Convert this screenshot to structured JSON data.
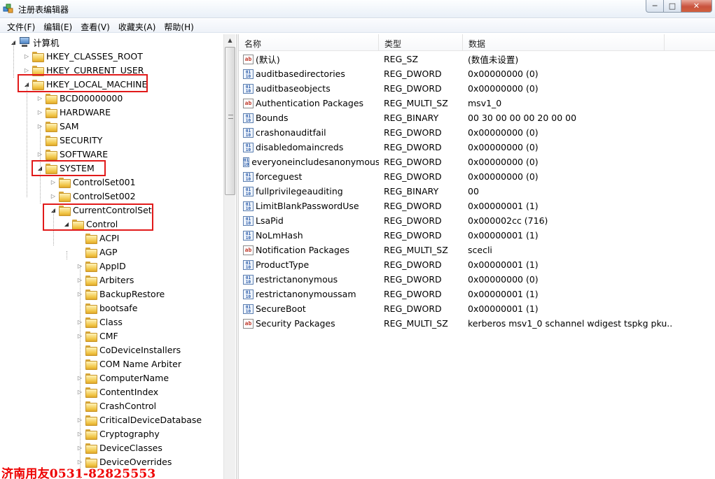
{
  "window": {
    "title": "注册表编辑器"
  },
  "menu": [
    "文件(F)",
    "编辑(E)",
    "查看(V)",
    "收藏夹(A)",
    "帮助(H)"
  ],
  "tree": [
    {
      "label": "计算机",
      "expander": "open",
      "icon": "computer-icon"
    },
    {
      "label": "HKEY_CLASSES_ROOT",
      "expander": "closed",
      "icon": "folder-icon"
    },
    {
      "label": "HKEY_CURRENT_USER",
      "expander": "closed",
      "icon": "folder-icon"
    },
    {
      "label": "HKEY_LOCAL_MACHINE",
      "expander": "open",
      "icon": "folder-icon"
    },
    {
      "label": "BCD00000000",
      "expander": "closed",
      "icon": "folder-icon"
    },
    {
      "label": "HARDWARE",
      "expander": "closed",
      "icon": "folder-icon"
    },
    {
      "label": "SAM",
      "expander": "closed",
      "icon": "folder-icon"
    },
    {
      "label": "SECURITY",
      "expander": "none",
      "icon": "folder-icon"
    },
    {
      "label": "SOFTWARE",
      "expander": "closed",
      "icon": "folder-icon"
    },
    {
      "label": "SYSTEM",
      "expander": "open",
      "icon": "folder-icon"
    },
    {
      "label": "ControlSet001",
      "expander": "closed",
      "icon": "folder-icon"
    },
    {
      "label": "ControlSet002",
      "expander": "closed",
      "icon": "folder-icon"
    },
    {
      "label": "CurrentControlSet",
      "expander": "open",
      "icon": "folder-icon"
    },
    {
      "label": "Control",
      "expander": "open",
      "icon": "folder-icon"
    },
    {
      "label": "ACPI",
      "expander": "none",
      "icon": "folder-icon"
    },
    {
      "label": "AGP",
      "expander": "none",
      "icon": "folder-icon"
    },
    {
      "label": "AppID",
      "expander": "closed",
      "icon": "folder-icon"
    },
    {
      "label": "Arbiters",
      "expander": "closed",
      "icon": "folder-icon"
    },
    {
      "label": "BackupRestore",
      "expander": "closed",
      "icon": "folder-icon"
    },
    {
      "label": "bootsafe",
      "expander": "none",
      "icon": "folder-icon"
    },
    {
      "label": "Class",
      "expander": "closed",
      "icon": "folder-icon"
    },
    {
      "label": "CMF",
      "expander": "closed",
      "icon": "folder-icon"
    },
    {
      "label": "CoDeviceInstallers",
      "expander": "none",
      "icon": "folder-icon"
    },
    {
      "label": "COM Name Arbiter",
      "expander": "none",
      "icon": "folder-icon"
    },
    {
      "label": "ComputerName",
      "expander": "closed",
      "icon": "folder-icon"
    },
    {
      "label": "ContentIndex",
      "expander": "closed",
      "icon": "folder-icon"
    },
    {
      "label": "CrashControl",
      "expander": "none",
      "icon": "folder-icon"
    },
    {
      "label": "CriticalDeviceDatabase",
      "expander": "closed",
      "icon": "folder-icon"
    },
    {
      "label": "Cryptography",
      "expander": "closed",
      "icon": "folder-icon"
    },
    {
      "label": "DeviceClasses",
      "expander": "closed",
      "icon": "folder-icon"
    },
    {
      "label": "DeviceOverrides",
      "expander": "closed",
      "icon": "folder-icon"
    }
  ],
  "list": {
    "columns": [
      "名称",
      "类型",
      "数据"
    ],
    "rows": [
      {
        "icon": "string-value-icon",
        "name": "(默认)",
        "type": "REG_SZ",
        "data": "(数值未设置)"
      },
      {
        "icon": "binary-value-icon",
        "name": "auditbasedirectories",
        "type": "REG_DWORD",
        "data": "0x00000000 (0)"
      },
      {
        "icon": "binary-value-icon",
        "name": "auditbaseobjects",
        "type": "REG_DWORD",
        "data": "0x00000000 (0)"
      },
      {
        "icon": "string-value-icon",
        "name": "Authentication Packages",
        "type": "REG_MULTI_SZ",
        "data": "msv1_0"
      },
      {
        "icon": "binary-value-icon",
        "name": "Bounds",
        "type": "REG_BINARY",
        "data": "00 30 00 00 00 20 00 00"
      },
      {
        "icon": "binary-value-icon",
        "name": "crashonauditfail",
        "type": "REG_DWORD",
        "data": "0x00000000 (0)"
      },
      {
        "icon": "binary-value-icon",
        "name": "disabledomaincreds",
        "type": "REG_DWORD",
        "data": "0x00000000 (0)"
      },
      {
        "icon": "binary-value-icon",
        "name": "everyoneincludesanonymous",
        "type": "REG_DWORD",
        "data": "0x00000000 (0)"
      },
      {
        "icon": "binary-value-icon",
        "name": "forceguest",
        "type": "REG_DWORD",
        "data": "0x00000000 (0)"
      },
      {
        "icon": "binary-value-icon",
        "name": "fullprivilegeauditing",
        "type": "REG_BINARY",
        "data": "00"
      },
      {
        "icon": "binary-value-icon",
        "name": "LimitBlankPasswordUse",
        "type": "REG_DWORD",
        "data": "0x00000001 (1)"
      },
      {
        "icon": "binary-value-icon",
        "name": "LsaPid",
        "type": "REG_DWORD",
        "data": "0x000002cc (716)"
      },
      {
        "icon": "binary-value-icon",
        "name": "NoLmHash",
        "type": "REG_DWORD",
        "data": "0x00000001 (1)"
      },
      {
        "icon": "string-value-icon",
        "name": "Notification Packages",
        "type": "REG_MULTI_SZ",
        "data": "scecli"
      },
      {
        "icon": "binary-value-icon",
        "name": "ProductType",
        "type": "REG_DWORD",
        "data": "0x00000001 (1)"
      },
      {
        "icon": "binary-value-icon",
        "name": "restrictanonymous",
        "type": "REG_DWORD",
        "data": "0x00000000 (0)"
      },
      {
        "icon": "binary-value-icon",
        "name": "restrictanonymoussam",
        "type": "REG_DWORD",
        "data": "0x00000001 (1)"
      },
      {
        "icon": "binary-value-icon",
        "name": "SecureBoot",
        "type": "REG_DWORD",
        "data": "0x00000001 (1)"
      },
      {
        "icon": "string-value-icon",
        "name": "Security Packages",
        "type": "REG_MULTI_SZ",
        "data": "kerberos msv1_0 schannel wdigest tspkg pku..."
      }
    ]
  },
  "watermark": "济南用友0531-82825553",
  "colors": {
    "highlight_box": "#e11a1a",
    "watermark": "#e00000"
  }
}
